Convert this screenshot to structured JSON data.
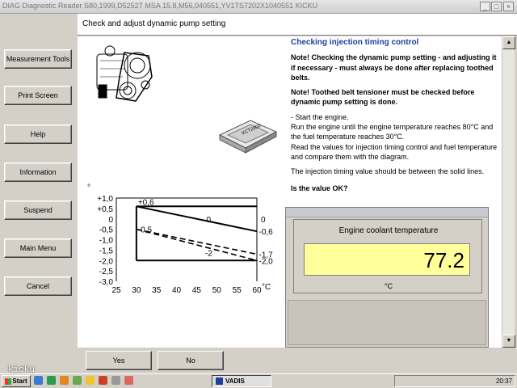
{
  "window": {
    "title": "DIAG Diagnostic Reader S80,1999,D5252T MSA 15.8,M56,040551,YV1TS7202X1040551 KICKU",
    "min_glyph": "_",
    "max_glyph": "□",
    "close_glyph": "×"
  },
  "sidebar": {
    "items": [
      {
        "label": "Measurement Tools"
      },
      {
        "label": "Print Screen"
      },
      {
        "label": "Help"
      },
      {
        "label": "Information"
      },
      {
        "label": "Suspend"
      },
      {
        "label": "Main Menu"
      },
      {
        "label": "Cancel"
      }
    ]
  },
  "header": {
    "title": "Check and adjust dynamic pump setting"
  },
  "instructions": {
    "heading": "Checking injection timing control",
    "note1": "Note! Checking the dynamic pump setting - and adjusting it if necessary - must always be done after replacing toothed belts.",
    "note2": "Note! Toothed belt tensioner must be checked before dynamic pump setting is done.",
    "step1": "-  Start the engine.",
    "step2": "Run the engine until the engine temperature reaches 80°C and the fuel temperature reaches 30°C.",
    "step3": "Read the values for injection timing control and fuel temperature and compare them with the diagram.",
    "step4": "The injection timing value should be between the solid lines.",
    "question": "Is the value OK?"
  },
  "device_label": "VCT2000",
  "chart_data": {
    "type": "line",
    "y_unit": "°",
    "x_unit": "°C",
    "x_ticks": [
      "25",
      "30",
      "35",
      "40",
      "45",
      "50",
      "55",
      "60"
    ],
    "y_ticks": [
      "+1,0",
      "+0,5",
      "0",
      "-0,5",
      "-1,0",
      "-1,5",
      "-2,0",
      "-2,5",
      "-3,0"
    ],
    "xlim": [
      25,
      60
    ],
    "ylim": [
      -3.0,
      1.0
    ],
    "series": [
      {
        "style": "solid",
        "x": [
          30,
          60
        ],
        "y": [
          0.6,
          0.6
        ]
      },
      {
        "style": "solid",
        "x": [
          30,
          60
        ],
        "y": [
          -2.0,
          -2.0
        ]
      },
      {
        "style": "solid",
        "x": [
          30,
          30
        ],
        "y": [
          0.6,
          -2.0
        ]
      },
      {
        "style": "solid",
        "x": [
          30,
          60
        ],
        "y": [
          0.6,
          -0.6
        ]
      },
      {
        "style": "dashed",
        "x": [
          30,
          60
        ],
        "y": [
          -0.5,
          -1.7
        ]
      },
      {
        "style": "dashed",
        "x": [
          30,
          60
        ],
        "y": [
          -0.5,
          -2.0
        ]
      }
    ],
    "annotations": [
      "+0,6",
      "-0,5",
      "0",
      "-2",
      "0",
      "-0,6",
      "-1,7",
      "-2,0"
    ]
  },
  "readout": {
    "label": "Engine coolant temperature",
    "value": "77.2",
    "unit": "°C",
    "highlight_color": "#ffff99"
  },
  "buttons": {
    "yes": "Yes",
    "no": "No"
  },
  "taskbar": {
    "start_label": "Start",
    "app_label": "VADIS",
    "clock": "20:37"
  },
  "watermark": "kicku"
}
